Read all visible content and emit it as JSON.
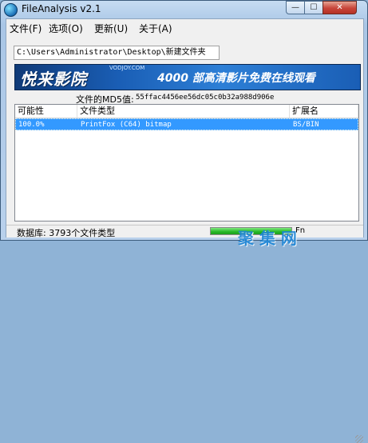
{
  "window": {
    "title": "FileAnalysis v2.1",
    "controls": {
      "minimize": "—",
      "maximize": "☐",
      "close": "✕"
    }
  },
  "menu": {
    "items": [
      "文件(F)",
      "选项(O)",
      "更新(U)",
      "关于(A)"
    ]
  },
  "path": {
    "value": "C:\\Users\\Administrator\\Desktop\\新建文件夹"
  },
  "banner": {
    "logo": "悦来影院",
    "site": "VODJOY.COM",
    "slogan": "4000 部高清影片免费在线观看"
  },
  "md5": {
    "label": "文件的MD5值:",
    "value": "55ffac4456ee56dc05c0b32a988d906e"
  },
  "table": {
    "columns": [
      "可能性",
      "文件类型",
      "扩展名"
    ],
    "rows": [
      {
        "probability": "100.0%",
        "type": "PrintFox (C64) bitmap",
        "ext": "BS/BIN"
      }
    ]
  },
  "status": {
    "text": "数据库: 3793个文件类型",
    "progress": 1.0,
    "fn": "Fn",
    "watermark": "聚 集 网"
  },
  "colors": {
    "selection": "#3399ff",
    "progress": "#27b827",
    "close_button": "#c8453a"
  }
}
